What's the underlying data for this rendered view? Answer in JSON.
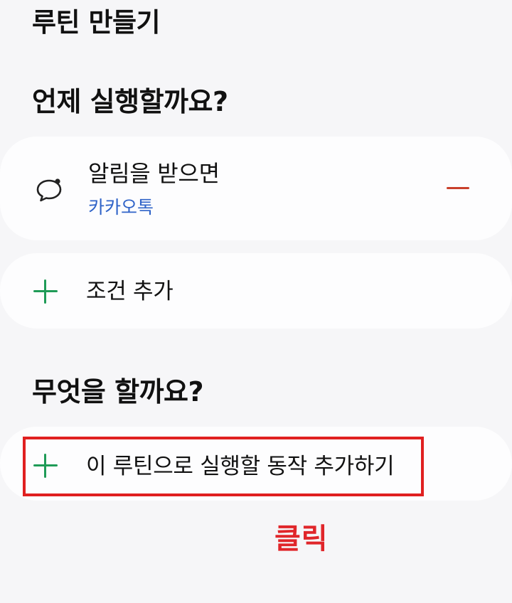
{
  "page": {
    "title": "루틴 만들기"
  },
  "when_section": {
    "heading": "언제 실행할까요?",
    "trigger": {
      "icon": "chat-bubble-icon",
      "title": "알림을 받으면",
      "app": "카카오톡",
      "app_color": "#2f63c8",
      "remove_icon": "minus-icon",
      "remove_color": "#c9402b"
    },
    "add_condition": {
      "icon": "plus-icon",
      "label": "조건 추가"
    }
  },
  "what_section": {
    "heading": "무엇을 할까요?",
    "add_action": {
      "icon": "plus-icon",
      "label": "이 루틴으로 실행할 동작 추가하기"
    }
  },
  "annotation": {
    "label": "클릭",
    "color": "#e0262a"
  },
  "colors": {
    "background": "#f6f6f8",
    "card": "#fdfdfe",
    "plus": "#1f9b57"
  }
}
